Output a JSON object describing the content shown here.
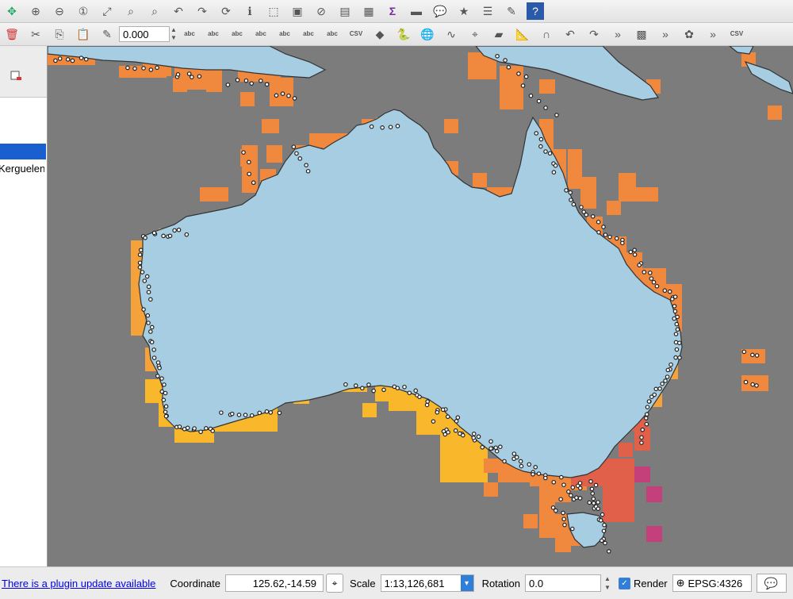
{
  "toolbar_top": {
    "items": [
      {
        "name": "pan-selected-icon",
        "glyph": "✥"
      },
      {
        "name": "zoom-in-icon",
        "glyph": "⊕"
      },
      {
        "name": "zoom-out-icon",
        "glyph": "⊖"
      },
      {
        "name": "zoom-native-icon",
        "glyph": "①"
      },
      {
        "name": "zoom-full-icon",
        "glyph": "⤢"
      },
      {
        "name": "zoom-selection-icon",
        "glyph": "⌕"
      },
      {
        "name": "zoom-layer-icon",
        "glyph": "⌕"
      },
      {
        "name": "zoom-last-icon",
        "glyph": "↶"
      },
      {
        "name": "zoom-next-icon",
        "glyph": "↷"
      },
      {
        "name": "refresh-icon",
        "glyph": "⟳"
      },
      {
        "name": "identify-icon",
        "glyph": "ℹ"
      },
      {
        "name": "select-features-icon",
        "glyph": "⬚"
      },
      {
        "name": "select-by-expression-icon",
        "glyph": "▣"
      },
      {
        "name": "deselect-all-icon",
        "glyph": "⊘"
      },
      {
        "name": "attribute-table-icon",
        "glyph": "▤"
      },
      {
        "name": "field-calculator-icon",
        "glyph": "▦"
      },
      {
        "name": "statistics-sigma-icon",
        "glyph": "Σ"
      },
      {
        "name": "measure-icon",
        "glyph": "▬"
      },
      {
        "name": "map-tips-icon",
        "glyph": "💬"
      },
      {
        "name": "new-bookmark-icon",
        "glyph": "★"
      },
      {
        "name": "show-bookmarks-icon",
        "glyph": "☰"
      },
      {
        "name": "text-annotation-icon",
        "glyph": "✎"
      },
      {
        "name": "help-icon",
        "glyph": "?"
      }
    ]
  },
  "toolbar_edit": {
    "tolerance_value": "0.000",
    "left_items": [
      {
        "name": "delete-icon",
        "glyph": "🗑"
      },
      {
        "name": "cut-icon",
        "glyph": "✂"
      },
      {
        "name": "copy-icon",
        "glyph": "⎘"
      },
      {
        "name": "paste-icon",
        "glyph": "📋"
      },
      {
        "name": "digitize-pencil-icon",
        "glyph": "✎"
      }
    ],
    "right_items": [
      {
        "name": "label-icon",
        "glyph": "abc"
      },
      {
        "name": "label-pin-icon",
        "glyph": "abc"
      },
      {
        "name": "label-highlight-icon",
        "glyph": "abc"
      },
      {
        "name": "label-show-hide-icon",
        "glyph": "abc"
      },
      {
        "name": "label-move-icon",
        "glyph": "abc"
      },
      {
        "name": "label-rotate-icon",
        "glyph": "abc"
      },
      {
        "name": "label-change-icon",
        "glyph": "abc"
      },
      {
        "name": "csv-icon",
        "glyph": "CSV"
      },
      {
        "name": "raster-icon",
        "glyph": "◆"
      },
      {
        "name": "python-icon",
        "glyph": "🐍"
      },
      {
        "name": "globe-icon",
        "glyph": "🌐"
      },
      {
        "name": "wave-icon",
        "glyph": "∿"
      },
      {
        "name": "pin-icon",
        "glyph": "⌖"
      },
      {
        "name": "sticky-note-icon",
        "glyph": "▰"
      },
      {
        "name": "ruler-icon",
        "glyph": "📐"
      },
      {
        "name": "magnet-icon",
        "glyph": "∩"
      },
      {
        "name": "undo-icon",
        "glyph": "↶"
      },
      {
        "name": "redo-icon",
        "glyph": "↷"
      },
      {
        "name": "more-icon",
        "glyph": "»"
      },
      {
        "name": "green-layer-icon",
        "glyph": "▩"
      },
      {
        "name": "more-icon",
        "glyph": "»"
      },
      {
        "name": "plugin-icon",
        "glyph": "✿"
      },
      {
        "name": "more-icon",
        "glyph": "»"
      },
      {
        "name": "csv-green-icon",
        "glyph": "CSV"
      }
    ]
  },
  "layers_panel": {
    "item_label": "Kerguelensem…"
  },
  "status_bar": {
    "plugin_update_text": "There is a plugin update available",
    "coordinate_label": "Coordinate",
    "coordinate_value": "125.62,-14.59",
    "scale_label": "Scale",
    "scale_value": "1:13,126,681",
    "rotation_label": "Rotation",
    "rotation_value": "0.0",
    "render_label": "Render",
    "crs_value": "EPSG:4326"
  },
  "map_colors": {
    "background": "#7c7c7c",
    "land": "#a6cde1",
    "land_outline": "#333333",
    "cell_orange": "#f0883e",
    "cell_light_orange": "#f5a23a",
    "cell_yellow": "#f9b72b",
    "cell_red": "#e0604a",
    "cell_magenta": "#c4407a",
    "point_fill": "#ffffff",
    "point_stroke": "#222222"
  }
}
